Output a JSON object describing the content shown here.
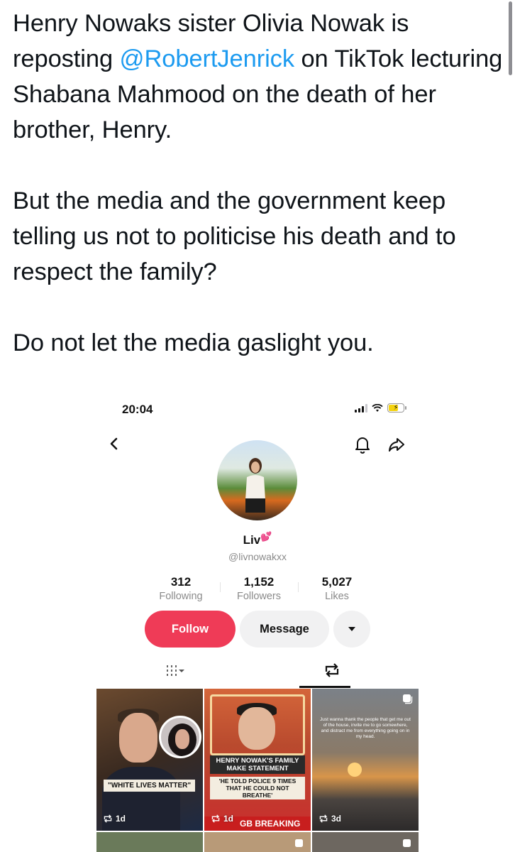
{
  "tweet": {
    "line1_before": "Henry Nowaks sister Olivia Nowak is reposting ",
    "mention": "@RobertJenrick",
    "line1_after": " on TikTok lecturing Shabana Mahmood on the death of her brother, Henry.",
    "para2": "But the media and the government keep telling us not to politicise his death and to respect the family?",
    "para3": "Do not let the media gaslight you."
  },
  "colors": {
    "mention": "#1d9bf0",
    "follow_button": "#ef3b57",
    "breaking_banner": "#c81e1e"
  },
  "screenshot": {
    "status_time": "20:04",
    "profile": {
      "display_name": "Liv",
      "name_emoji": "💕",
      "handle": "@livnowakxx",
      "stats": [
        {
          "value": "312",
          "label": "Following"
        },
        {
          "value": "1,152",
          "label": "Followers"
        },
        {
          "value": "5,027",
          "label": "Likes"
        }
      ],
      "follow_label": "Follow",
      "message_label": "Message"
    },
    "icons": {
      "back": "chevron-left-icon",
      "bell": "bell-icon",
      "share": "share-icon",
      "more": "caret-down-icon",
      "grid_tab": "grid-icon",
      "repost_tab": "repost-icon"
    },
    "videos": [
      {
        "overlay": "\"WHITE LIVES MATTER\"",
        "age": "1d"
      },
      {
        "title": "HENRY NOWAK'S FAMILY MAKE STATEMENT",
        "quote": "'HE TOLD POLICE 9 TIMES THAT HE COULD NOT BREATHE'",
        "banner": "GB BREAKING",
        "age": "1d"
      },
      {
        "caption": "Just wanna thank the people that get me out of the house, invite me to go somewhere, and distract me from everything going on in my head.",
        "age": "3d"
      }
    ]
  }
}
